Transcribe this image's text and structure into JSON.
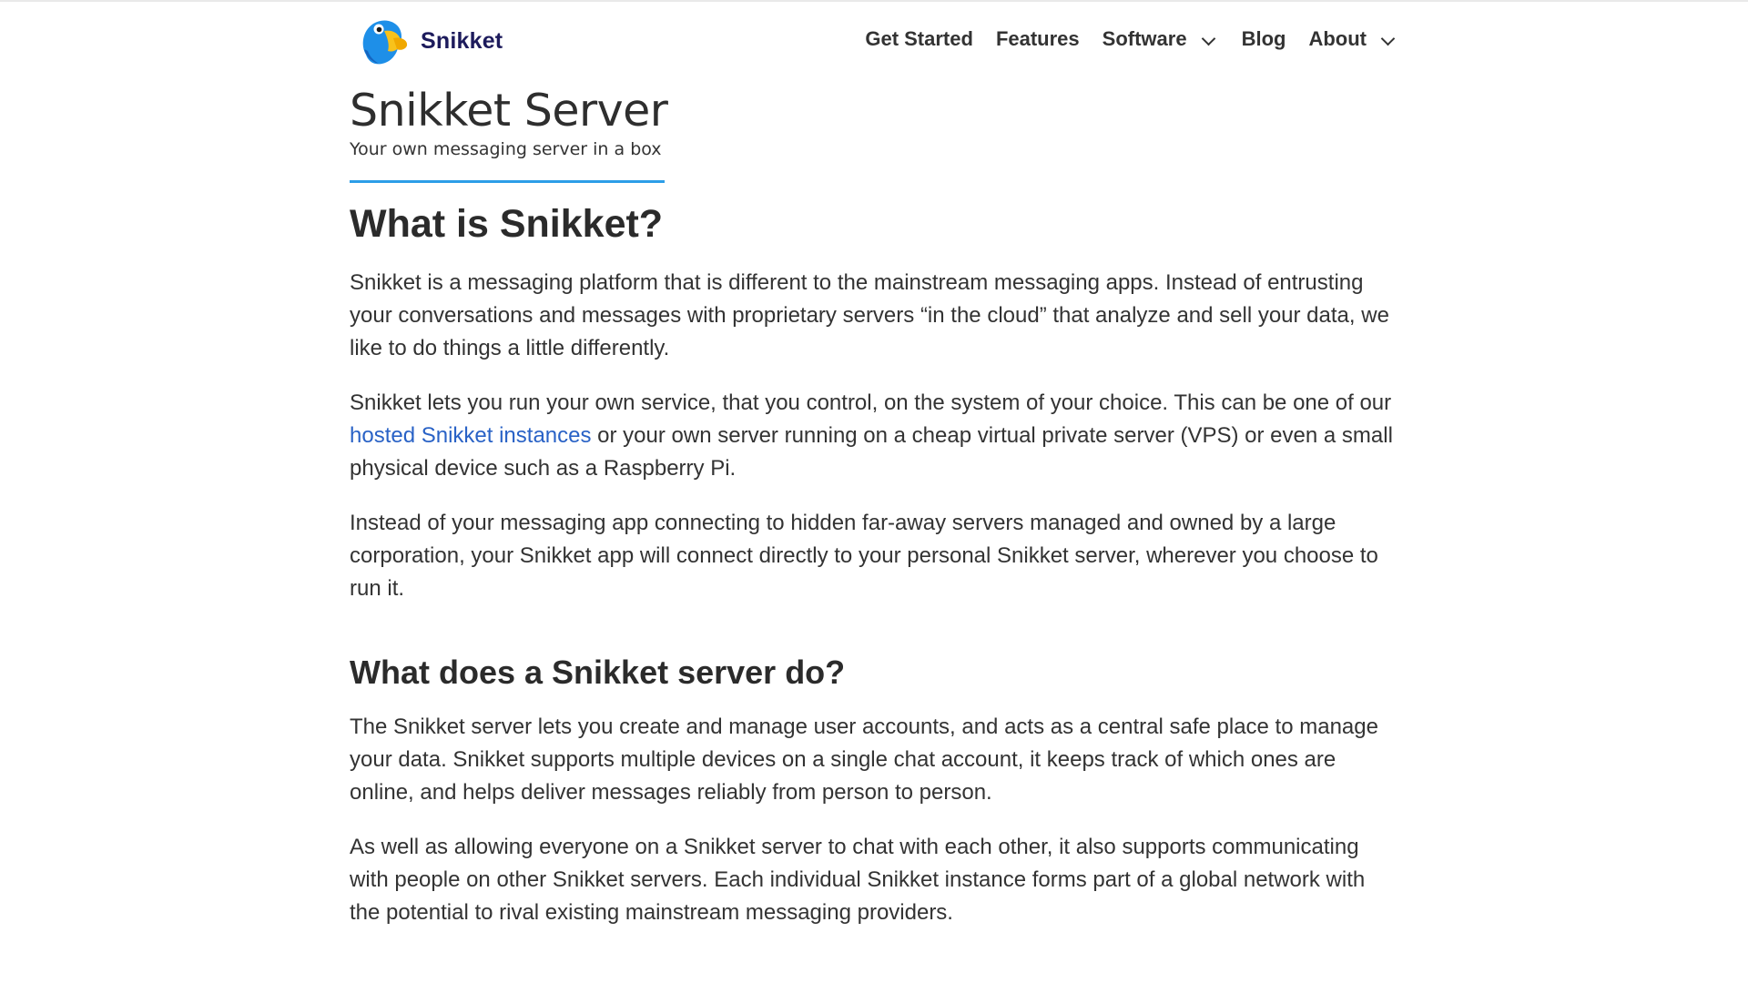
{
  "brand": {
    "name": "Snikket",
    "logo_icon": "parrot-logo-icon",
    "colors": {
      "blue": "#1e8fe8",
      "yellow": "#f8c21b",
      "navy": "#1d1b5c"
    }
  },
  "nav": {
    "items": [
      {
        "label": "Get Started",
        "has_dropdown": false
      },
      {
        "label": "Features",
        "has_dropdown": false
      },
      {
        "label": "Software",
        "has_dropdown": true
      },
      {
        "label": "Blog",
        "has_dropdown": false
      },
      {
        "label": "About",
        "has_dropdown": true
      }
    ]
  },
  "header": {
    "title": "Snikket Server",
    "subtitle": "Your own messaging server in a box",
    "accent_color": "#2d9ee8"
  },
  "sections": [
    {
      "heading": "What is Snikket?",
      "paragraphs": [
        {
          "text": "Snikket is a messaging platform that is different to the mainstream messaging apps. Instead of entrusting your conversations and messages with proprietary servers “in the cloud” that analyze and sell your data, we like to do things a little differently."
        },
        {
          "before": "Snikket lets you run your own service, that you control, on the system of your choice. This can be one of our ",
          "link": "hosted Snikket instances",
          "after": " or your own server running on a cheap virtual private server (VPS) or even a small physical device such as a Raspberry Pi."
        },
        {
          "text": "Instead of your messaging app connecting to hidden far-away servers managed and owned by a large corporation, your Snikket app will connect directly to your personal Snikket server, wherever you choose to run it."
        }
      ]
    },
    {
      "heading": "What does a Snikket server do?",
      "paragraphs": [
        {
          "text": "The Snikket server lets you create and manage user accounts, and acts as a central safe place to manage your data. Snikket supports multiple devices on a single chat account, it keeps track of which ones are online, and helps deliver messages reliably from person to person."
        },
        {
          "text": "As well as allowing everyone on a Snikket server to chat with each other, it also supports communicating with people on other Snikket servers. Each individual Snikket instance forms part of a global network with the potential to rival existing mainstream messaging providers."
        }
      ]
    }
  ],
  "link_color": "#2962c6"
}
